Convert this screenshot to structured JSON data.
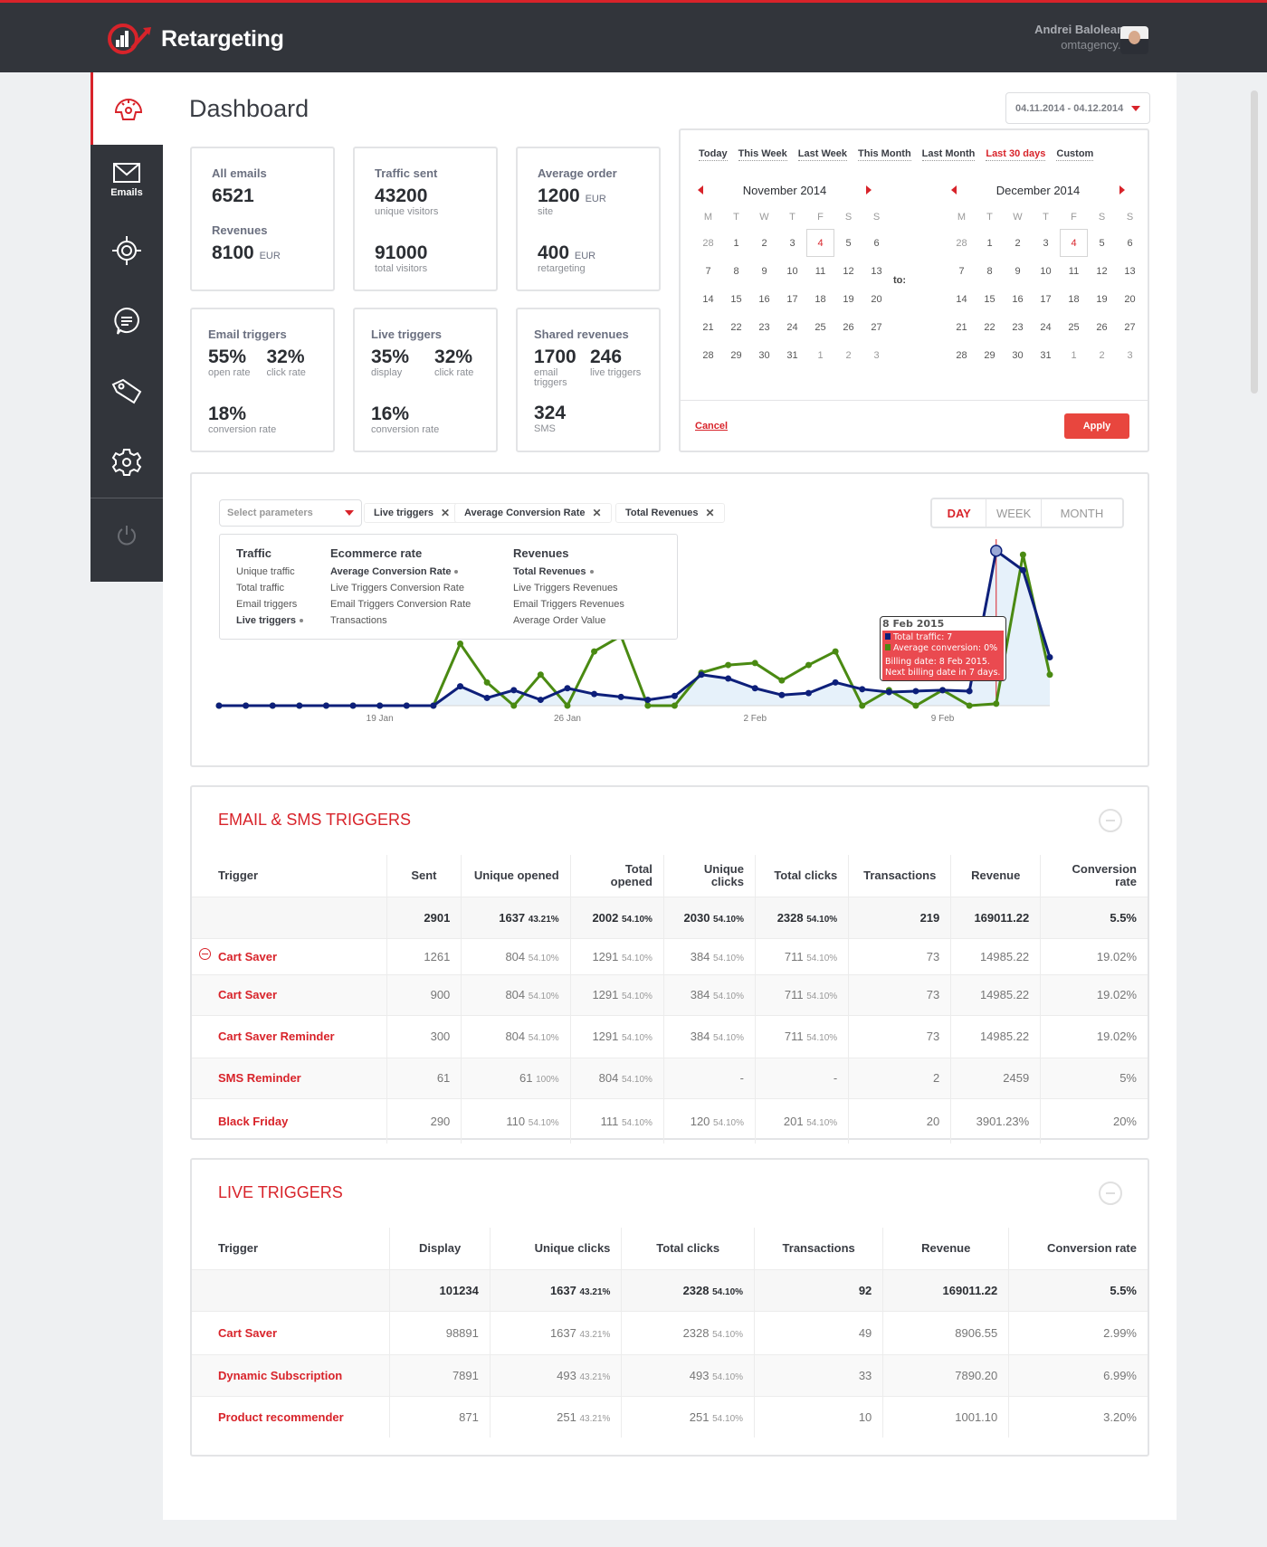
{
  "app": {
    "name": "Retargeting",
    "brand_color": "#d8232a"
  },
  "user": {
    "name": "Andrei Baloleanu",
    "site": "omtagency.ro"
  },
  "sidebar": {
    "items": [
      {
        "name": "dashboard",
        "label": ""
      },
      {
        "name": "emails",
        "label": "Emails"
      },
      {
        "name": "targeting",
        "label": ""
      },
      {
        "name": "messages",
        "label": ""
      },
      {
        "name": "tags",
        "label": ""
      },
      {
        "name": "settings",
        "label": ""
      },
      {
        "name": "logout",
        "label": ""
      }
    ]
  },
  "page": {
    "title": "Dashboard"
  },
  "date_range": {
    "value": "04.11.2014 - 04.12.2014"
  },
  "cards": {
    "all_emails": {
      "title": "All emails",
      "value": "6521",
      "sub_title": "Revenues",
      "sub_value": "8100",
      "sub_unit": "EUR"
    },
    "traffic": {
      "title": "Traffic sent",
      "value": "43200",
      "value_label": "unique visitors",
      "value2": "91000",
      "value2_label": "total visitors"
    },
    "avg_order": {
      "title": "Average order",
      "value": "1200",
      "unit": "EUR",
      "value_label": "site",
      "value2": "400",
      "unit2": "EUR",
      "value2_label": "retargeting"
    },
    "email_triggers": {
      "title": "Email triggers",
      "a": "55%",
      "a_label": "open rate",
      "b": "32%",
      "b_label": "click rate",
      "c": "18%",
      "c_label": "conversion rate"
    },
    "live_triggers": {
      "title": "Live triggers",
      "a": "35%",
      "a_label": "display",
      "b": "32%",
      "b_label": "click rate",
      "c": "16%",
      "c_label": "conversion rate"
    },
    "shared": {
      "title": "Shared revenues",
      "a": "1700",
      "a_label": "email triggers",
      "b": "246",
      "b_label": "live triggers",
      "c": "324",
      "c_label": "SMS"
    }
  },
  "calendar": {
    "presets": [
      "Today",
      "This Week",
      "Last Week",
      "This Month",
      "Last Month",
      "Last 30 days",
      "Custom"
    ],
    "selected_preset": "Last 30 days",
    "to_label": "to:",
    "dow": [
      "M",
      "T",
      "W",
      "T",
      "F",
      "S",
      "S"
    ],
    "left": {
      "title": "November 2014",
      "today": "4",
      "weeks": [
        [
          "28",
          "1",
          "2",
          "3",
          "4",
          "5",
          "6"
        ],
        [
          "7",
          "8",
          "9",
          "10",
          "11",
          "12",
          "13"
        ],
        [
          "14",
          "15",
          "16",
          "17",
          "18",
          "19",
          "20"
        ],
        [
          "21",
          "22",
          "23",
          "24",
          "25",
          "26",
          "27"
        ],
        [
          "28",
          "29",
          "30",
          "31",
          "1",
          "2",
          "3"
        ]
      ]
    },
    "right": {
      "title": "December 2014",
      "today": "4",
      "weeks": [
        [
          "28",
          "1",
          "2",
          "3",
          "4",
          "5",
          "6"
        ],
        [
          "7",
          "8",
          "9",
          "10",
          "11",
          "12",
          "13"
        ],
        [
          "14",
          "15",
          "16",
          "17",
          "18",
          "19",
          "20"
        ],
        [
          "21",
          "22",
          "23",
          "24",
          "25",
          "26",
          "27"
        ],
        [
          "28",
          "29",
          "30",
          "31",
          "1",
          "2",
          "3"
        ]
      ]
    },
    "cancel": "Cancel",
    "apply": "Apply"
  },
  "chart_controls": {
    "select_placeholder": "Select parameters",
    "chips": [
      "Live triggers",
      "Average Conversion Rate",
      "Total Revenues"
    ],
    "periods": [
      "DAY",
      "WEEK",
      "MONTH"
    ],
    "active_period": "DAY",
    "param_groups": [
      {
        "title": "Traffic",
        "items": [
          {
            "label": "Unique traffic",
            "on": false
          },
          {
            "label": "Total traffic",
            "on": false
          },
          {
            "label": "Email triggers",
            "on": false
          },
          {
            "label": "Live triggers",
            "on": true
          }
        ]
      },
      {
        "title": "Ecommerce rate",
        "items": [
          {
            "label": "Average Conversion Rate",
            "on": true
          },
          {
            "label": "Live Triggers Conversion Rate",
            "on": false
          },
          {
            "label": "Email Triggers Conversion Rate",
            "on": false
          },
          {
            "label": "Transactions",
            "on": false
          }
        ]
      },
      {
        "title": "Revenues",
        "items": [
          {
            "label": "Total Revenues",
            "on": true
          },
          {
            "label": "Live Triggers Revenues",
            "on": false
          },
          {
            "label": "Email Triggers Revenues",
            "on": false
          },
          {
            "label": "Average Order Value",
            "on": false
          }
        ]
      }
    ]
  },
  "chart_data": {
    "type": "line",
    "x_ticks": [
      "19 Jan",
      "26 Jan",
      "2 Feb",
      "9 Feb"
    ],
    "x_tick_index": [
      6,
      13,
      20,
      27
    ],
    "series": [
      {
        "name": "Total traffic",
        "color": "#0d1f7a",
        "values": [
          0,
          0,
          0,
          0,
          0,
          0,
          0,
          0,
          0,
          1,
          0.4,
          0.8,
          0.3,
          0.9,
          0.6,
          0.45,
          0.3,
          0.5,
          1.6,
          1.4,
          0.9,
          0.55,
          0.65,
          1.2,
          0.85,
          0.7,
          0.75,
          0.8,
          0.75,
          8,
          7,
          2.5
        ]
      },
      {
        "name": "Average conversion",
        "color": "#4a8a12",
        "values": [
          0,
          0,
          0,
          0,
          0,
          0,
          0,
          0,
          0,
          3.2,
          1.2,
          0,
          1.6,
          0,
          2.8,
          3.6,
          0,
          0,
          1.7,
          2.1,
          2.2,
          1.3,
          2.1,
          2.8,
          0,
          0.8,
          0,
          0.8,
          0,
          0.1,
          7.8,
          1.6
        ]
      }
    ],
    "ylim": [
      0,
      8.6
    ],
    "highlight_index": 29,
    "tooltip": {
      "date": "8 Feb 2015",
      "lines": [
        "Total traffic: 7",
        "Average conversion: 0%"
      ],
      "note1": "Billing date: 8 Feb 2015.",
      "note2": "Next billing date in 7 days."
    }
  },
  "email_sms": {
    "title": "EMAIL & SMS TRIGGERS",
    "columns": [
      "Trigger",
      "Sent",
      "Unique opened",
      "Total opened",
      "Unique clicks",
      "Total clicks",
      "Transactions",
      "Revenue",
      "Conversion rate"
    ],
    "total": [
      "",
      "2901",
      [
        "1637",
        "43.21%"
      ],
      [
        "2002",
        "54.10%"
      ],
      [
        "2030",
        "54.10%"
      ],
      [
        "2328",
        "54.10%"
      ],
      "219",
      "169011.22",
      "5.5%"
    ],
    "rows": [
      [
        "Cart Saver",
        "1261",
        [
          "804",
          "54.10%"
        ],
        [
          "1291",
          "54.10%"
        ],
        [
          "384",
          "54.10%"
        ],
        [
          "711",
          "54.10%"
        ],
        "73",
        "14985.22",
        "19.02%"
      ],
      [
        "Cart Saver",
        "900",
        [
          "804",
          "54.10%"
        ],
        [
          "1291",
          "54.10%"
        ],
        [
          "384",
          "54.10%"
        ],
        [
          "711",
          "54.10%"
        ],
        "73",
        "14985.22",
        "19.02%"
      ],
      [
        "Cart Saver Reminder",
        "300",
        [
          "804",
          "54.10%"
        ],
        [
          "1291",
          "54.10%"
        ],
        [
          "384",
          "54.10%"
        ],
        [
          "711",
          "54.10%"
        ],
        "73",
        "14985.22",
        "19.02%"
      ],
      [
        "SMS Reminder",
        "61",
        [
          "61",
          "100%"
        ],
        [
          "804",
          "54.10%"
        ],
        "-",
        "-",
        "2",
        "2459",
        "5%"
      ],
      [
        "Black Friday",
        "290",
        [
          "110",
          "54.10%"
        ],
        [
          "111",
          "54.10%"
        ],
        [
          "120",
          "54.10%"
        ],
        [
          "201",
          "54.10%"
        ],
        "20",
        "3901.23%",
        "20%"
      ]
    ]
  },
  "live": {
    "title": "LIVE TRIGGERS",
    "columns": [
      "Trigger",
      "Display",
      "Unique clicks",
      "Total clicks",
      "Transactions",
      "Revenue",
      "Conversion rate"
    ],
    "total": [
      "",
      "101234",
      [
        "1637",
        "43.21%"
      ],
      [
        "2328",
        "54.10%"
      ],
      "92",
      "169011.22",
      "5.5%"
    ],
    "rows": [
      [
        "Cart Saver",
        "98891",
        [
          "1637",
          "43.21%"
        ],
        [
          "2328",
          "54.10%"
        ],
        "49",
        "8906.55",
        "2.99%"
      ],
      [
        "Dynamic Subscription",
        "7891",
        [
          "493",
          "43.21%"
        ],
        [
          "493",
          "54.10%"
        ],
        "33",
        "7890.20",
        "6.99%"
      ],
      [
        "Product recommender",
        "871",
        [
          "251",
          "43.21%"
        ],
        [
          "251",
          "54.10%"
        ],
        "10",
        "1001.10",
        "3.20%"
      ]
    ]
  }
}
